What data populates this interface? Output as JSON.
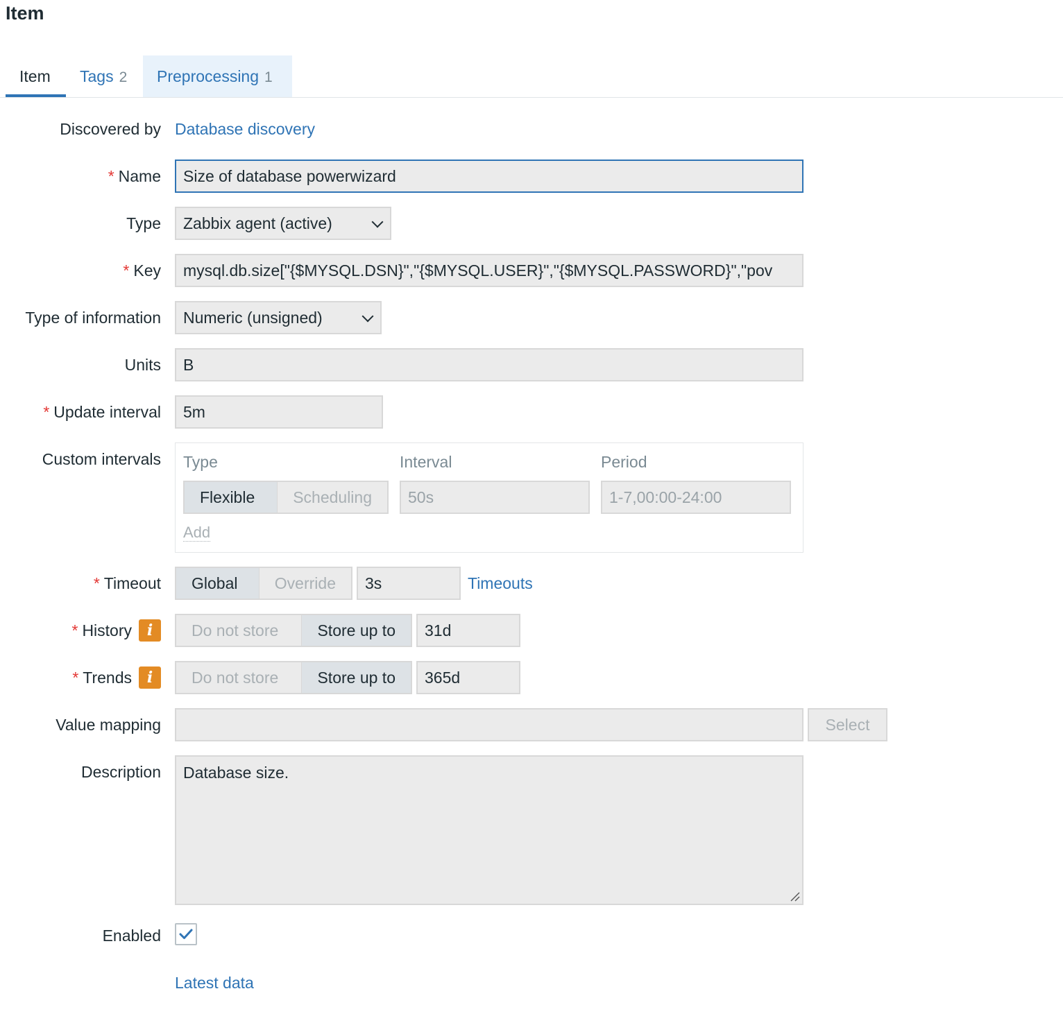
{
  "page": {
    "title": "Item"
  },
  "tabs": [
    {
      "label": "Item",
      "count": ""
    },
    {
      "label": "Tags",
      "count": "2"
    },
    {
      "label": "Preprocessing",
      "count": "1"
    }
  ],
  "form": {
    "discovered_by": {
      "label": "Discovered by",
      "value": "Database discovery"
    },
    "name": {
      "label": "Name",
      "value": "Size of database powerwizard"
    },
    "type": {
      "label": "Type",
      "value": "Zabbix agent (active)"
    },
    "key": {
      "label": "Key",
      "value": "mysql.db.size[\"{$MYSQL.DSN}\",\"{$MYSQL.USER}\",\"{$MYSQL.PASSWORD}\",\"pov"
    },
    "type_of_information": {
      "label": "Type of information",
      "value": "Numeric (unsigned)"
    },
    "units": {
      "label": "Units",
      "value": "B"
    },
    "update_interval": {
      "label": "Update interval",
      "value": "5m"
    },
    "custom_intervals": {
      "label": "Custom intervals",
      "headers": {
        "type": "Type",
        "interval": "Interval",
        "period": "Period"
      },
      "type_options": [
        "Flexible",
        "Scheduling"
      ],
      "selected_type": "Flexible",
      "interval_value": "50s",
      "period_value": "1-7,00:00-24:00",
      "add_label": "Add"
    },
    "timeout": {
      "label": "Timeout",
      "options": [
        "Global",
        "Override"
      ],
      "selected": "Global",
      "value": "3s",
      "link": "Timeouts"
    },
    "history": {
      "label": "History",
      "options": [
        "Do not store",
        "Store up to"
      ],
      "selected": "Store up to",
      "value": "31d"
    },
    "trends": {
      "label": "Trends",
      "options": [
        "Do not store",
        "Store up to"
      ],
      "selected": "Store up to",
      "value": "365d"
    },
    "value_mapping": {
      "label": "Value mapping",
      "value": "",
      "button": "Select"
    },
    "description": {
      "label": "Description",
      "value": "Database size."
    },
    "enabled": {
      "label": "Enabled",
      "checked": true
    },
    "latest_data_link": "Latest data"
  },
  "colors": {
    "link": "#2f74b5",
    "required": "#e33734",
    "info_icon": "#e38b24",
    "active_tab_underline": "#2f74b5"
  },
  "icons": [
    "info-icon",
    "chevron-down-icon",
    "checkmark-icon",
    "resize-grip-icon"
  ]
}
